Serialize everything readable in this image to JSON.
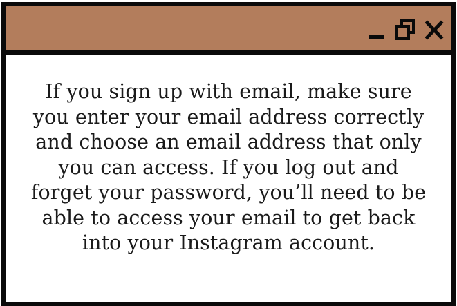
{
  "window": {
    "titlebar_color": "#b37d5c",
    "border_color": "#0a0a0a",
    "controls": {
      "minimize_icon": "minimize-icon",
      "maximize_icon": "restore-icon",
      "close_icon": "close-icon"
    }
  },
  "content": {
    "message_lines": [
      "If you sign up with email, make sure",
      "you enter your email address correctly",
      "and choose an email address that only",
      "you can access. If you log out and",
      "forget your password, you’ll need to be",
      "able to access your email to get back",
      "into your Instagram account."
    ]
  }
}
